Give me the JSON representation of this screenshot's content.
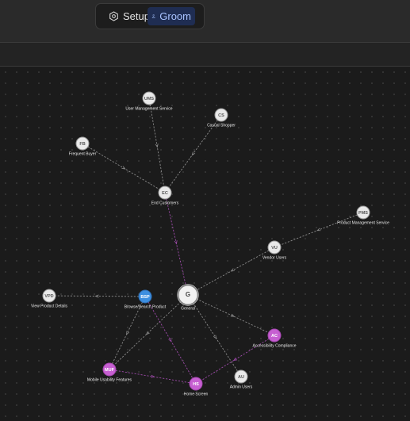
{
  "toolbar": {
    "setup_label": "Setup",
    "groom_label": "Groom",
    "active": "groom",
    "accent_active_bg": "#1f2d52",
    "accent_active_fg": "#a9c3ff"
  },
  "graph": {
    "colors": {
      "default_node": "#e9e9e9",
      "selected_node": "#3d8fe0",
      "highlight_node": "#c65fd1",
      "edge_default": "#8a8a8a",
      "edge_highlight": "#9c4aa8"
    },
    "nodes": [
      {
        "id": "UMS",
        "abbr": "UMS",
        "label": "User Management Service",
        "kind": "default"
      },
      {
        "id": "CS",
        "abbr": "CS",
        "label": "Casual Shopper",
        "kind": "default"
      },
      {
        "id": "FB",
        "abbr": "FB",
        "label": "Frequent Buyer",
        "kind": "default"
      },
      {
        "id": "EC",
        "abbr": "EC",
        "label": "End Customers",
        "kind": "default"
      },
      {
        "id": "PMS",
        "abbr": "PMS",
        "label": "Product Management Service",
        "kind": "default"
      },
      {
        "id": "VU",
        "abbr": "VU",
        "label": "Vendor Users",
        "kind": "default"
      },
      {
        "id": "VPD",
        "abbr": "VPD",
        "label": "View Product Details",
        "kind": "default"
      },
      {
        "id": "BSP",
        "abbr": "BSP",
        "label": "Browse/Search Product",
        "kind": "selected"
      },
      {
        "id": "G",
        "abbr": "G",
        "label": "General",
        "kind": "root"
      },
      {
        "id": "AC",
        "abbr": "AC",
        "label": "Accessibility Compliance",
        "kind": "highlight"
      },
      {
        "id": "MUF",
        "abbr": "MUF",
        "label": "Mobile Usability Features",
        "kind": "highlight"
      },
      {
        "id": "HS",
        "abbr": "HS",
        "label": "Home Screen",
        "kind": "highlight"
      },
      {
        "id": "AU",
        "abbr": "AU",
        "label": "Admin Users",
        "kind": "default"
      }
    ],
    "edges": [
      {
        "from": "UMS",
        "to": "EC",
        "style": "default"
      },
      {
        "from": "CS",
        "to": "EC",
        "style": "default"
      },
      {
        "from": "FB",
        "to": "EC",
        "style": "default"
      },
      {
        "from": "EC",
        "to": "G",
        "style": "highlight"
      },
      {
        "from": "PMS",
        "to": "VU",
        "style": "default"
      },
      {
        "from": "VU",
        "to": "G",
        "style": "default"
      },
      {
        "from": "BSP",
        "to": "VPD",
        "style": "default"
      },
      {
        "from": "G",
        "to": "AC",
        "style": "default"
      },
      {
        "from": "G",
        "to": "AU",
        "style": "default"
      },
      {
        "from": "G",
        "to": "MUF",
        "style": "default"
      },
      {
        "from": "BSP",
        "to": "MUF",
        "style": "default"
      },
      {
        "from": "BSP",
        "to": "HS",
        "style": "highlight"
      },
      {
        "from": "MUF",
        "to": "HS",
        "style": "highlight"
      },
      {
        "from": "AC",
        "to": "HS",
        "style": "highlight"
      }
    ]
  }
}
